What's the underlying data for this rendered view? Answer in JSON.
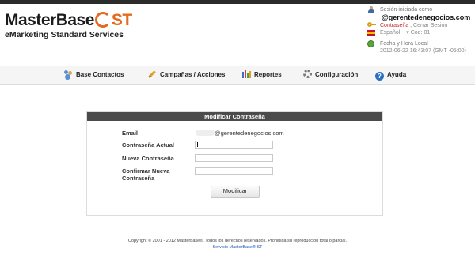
{
  "logo": {
    "brand": "MasterBase",
    "suffix": "ST",
    "tagline": "eMarketing Standard Services"
  },
  "session": {
    "started_label": "Sesión iniciada como",
    "email": "@gerentedenegocios.com",
    "password_link": "Contraseña",
    "separator": " ; ",
    "logout_link": "Cerrar Sesión",
    "language": "Español",
    "code": "Cod: 01",
    "datetime_label": "Fecha y Hora Local",
    "datetime_value": "2012-06-22 16:43:07  (GMT -05:00)"
  },
  "nav": {
    "items": [
      {
        "label": "Base Contactos",
        "icon": "contacts-icon"
      },
      {
        "label": "Campañas / Acciones",
        "icon": "pencil-icon"
      },
      {
        "label": "Reportes",
        "icon": "bar-chart-icon"
      },
      {
        "label": "Configuración",
        "icon": "gear-icon"
      },
      {
        "label": "Ayuda",
        "icon": "help-icon"
      }
    ]
  },
  "form": {
    "title": "Modificar Contraseña",
    "email_label": "Email",
    "email_value": "@gerentedenegocios.com",
    "current_label": "Contraseña Actual",
    "current_value": "",
    "new_label": "Nueva Contraseña",
    "new_value": "",
    "confirm_label_1": "Confirmar Nueva",
    "confirm_label_2": "Contraseña",
    "confirm_value": "",
    "submit_label": "Modificar"
  },
  "footer": {
    "copyright": "Copyright © 2001 - 2012 Masterbase®. Todos los derechos reservados. Prohibida su reproducción total o parcial.",
    "link": "Servicio MasterBase® ST"
  },
  "colors": {
    "accent": "#e36b1e",
    "panel_header": "#4b4b4b",
    "link_red": "#c62828",
    "link_blue": "#1f56b3"
  }
}
